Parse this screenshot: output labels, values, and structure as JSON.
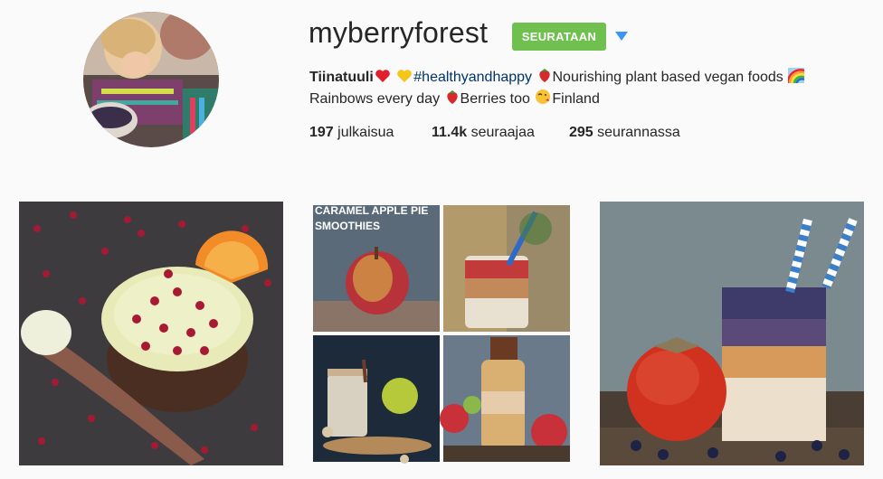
{
  "profile": {
    "username": "myberryforest",
    "follow_label": "SEURATAAN",
    "bio": {
      "name": "Tiinatuuli",
      "hashtag": "#healthyandhappy",
      "text1": "Nourishing plant based vegan foods",
      "text2": "Rainbows every day",
      "text3": "Berries too",
      "text4": "Finland"
    },
    "stats": {
      "posts_count": "197",
      "posts_label": "julkaisua",
      "followers_count": "11.4k",
      "followers_label": "seuraajaa",
      "following_count": "295",
      "following_label": "seurannassa"
    }
  },
  "posts": [
    {
      "icon": "chocolate-cake-with-pomegranate-image"
    },
    {
      "icon": "caramel-apple-pie-smoothie-collage-image",
      "caption_line1": "CARAMEL APPLE PIE",
      "caption_line2": "SMOOTHIES"
    },
    {
      "icon": "persimmon-berry-smoothie-jar-image"
    }
  ],
  "colors": {
    "follow_green": "#70c050",
    "link_blue": "#003569",
    "dropdown_blue": "#3897f0"
  }
}
